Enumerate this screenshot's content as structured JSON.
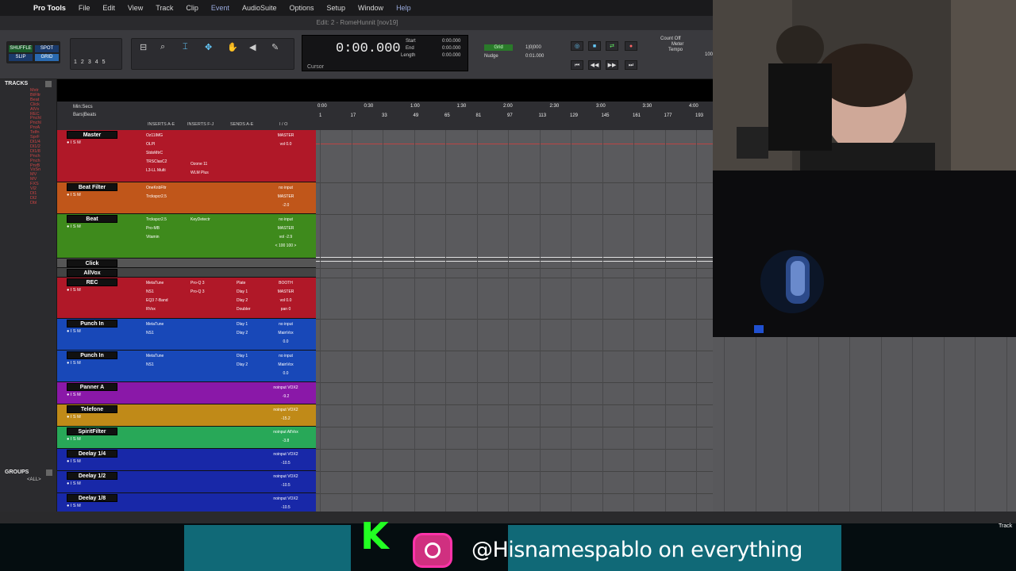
{
  "menubar": {
    "app": "Pro Tools",
    "items": [
      "File",
      "Edit",
      "View",
      "Track",
      "Clip",
      "Event",
      "AudioSuite",
      "Options",
      "Setup",
      "Window",
      "Help"
    ]
  },
  "window_title": "Edit: 2 - RomeHunnit [nov19]",
  "toolbar": {
    "mode_shuffle": "SHUFFLE",
    "mode_spot": "SPOT",
    "mode_slip": "SLIP",
    "mode_grid": "GRID",
    "zoom_presets": [
      "1",
      "2",
      "3",
      "4",
      "5"
    ],
    "counter_main": "0:00.000",
    "start_label": "Start",
    "end_label": "End",
    "length_label": "Length",
    "start_val": "0:00.000",
    "end_val": "0:00.000",
    "length_val": "0:00.000",
    "cursor_label": "Cursor",
    "grid_label": "Grid",
    "nudge_label": "Nudge",
    "grid_val": "1|0|000",
    "nudge_val": "0:01.000",
    "count_off": "Count Off",
    "meter": "Meter",
    "tempo": "Tempo",
    "tempo_val": "100"
  },
  "tracks_panel": {
    "header": "TRACKS",
    "items": [
      "Mstr",
      "BtFltr",
      "Beat",
      "Click",
      "AlVx",
      "REC",
      "Pnchl",
      "Pnchl",
      "PnrA",
      "Telfn",
      "SprF",
      "Dl1/4",
      "Dl1/2",
      "Dl1/8",
      "Pnch",
      "Pnch",
      "PnrB",
      "VxSn",
      "MV",
      "MV",
      "FXS",
      "Vl2",
      "Dl1",
      "Dl2",
      "Dbl"
    ],
    "groups_header": "GROUPS",
    "groups_all": "<ALL>"
  },
  "mix_header": {
    "timecode": "Min:Secs",
    "bars": "Bars|Beats",
    "col_inserts_ae": "INSERTS A-E",
    "col_inserts_fj": "INSERTS F-J",
    "col_sends": "SENDS A-E",
    "col_io": "I / O"
  },
  "ruler": {
    "minsecs": [
      "0:00",
      "0:30",
      "1:00",
      "1:30",
      "2:00",
      "2:30",
      "3:00",
      "3:30",
      "4:00"
    ],
    "bars": [
      "1",
      "17",
      "33",
      "49",
      "65",
      "81",
      "97",
      "113",
      "129",
      "145",
      "161",
      "177",
      "193"
    ]
  },
  "tracks": [
    {
      "name": "Master",
      "color": "#b01828",
      "inserts": [
        "Oz11IMG",
        "OLPI",
        "StdoMtrC",
        "TRSClasC2",
        "L3-LL Multi"
      ],
      "inserts2": [
        "Ozone 11",
        "WLM Plus"
      ],
      "io": [
        "MASTER",
        "vol  0.0"
      ]
    },
    {
      "name": "Beat Filter",
      "color": "#c0561a",
      "inserts": [
        "OneKnbFltr",
        "Trckspcr2.5"
      ],
      "inserts2": [],
      "io": [
        "no input",
        "MASTER",
        "-2.0"
      ]
    },
    {
      "name": "Beat",
      "color": "#3e8a1c",
      "inserts": [
        "Trckspcr2.5",
        "Pro-MB",
        "Vitamin"
      ],
      "inserts2": [
        "KeyDetectr"
      ],
      "io": [
        "no input",
        "MASTER",
        "vol  -2.9",
        "< 100  100 >"
      ]
    },
    {
      "name": "Click",
      "color": "#555",
      "inserts": [],
      "inserts2": [],
      "io": []
    },
    {
      "name": "AllVox",
      "color": "#444",
      "inserts": [],
      "inserts2": [],
      "io": []
    },
    {
      "name": "REC",
      "color": "#b01828",
      "inserts": [
        "MetaTune",
        "NS1",
        "EQ3 7-Band",
        "RVox"
      ],
      "inserts2": [
        "Pro-Q 3",
        "Pro-Q 3"
      ],
      "io": [
        "BOOTH",
        "MASTER",
        "vol  0.0",
        "pan  0"
      ],
      "sends": [
        "Plate",
        "Dlay 1",
        "Dlay 2",
        "Doubler"
      ]
    },
    {
      "name": "Punch In",
      "color": "#1848b8",
      "inserts": [
        "MetaTune",
        "NS1"
      ],
      "inserts2": [],
      "io": [
        "no input",
        "MainVox",
        "0.0"
      ],
      "sends": [
        "Dlay 1",
        "Dlay 2"
      ]
    },
    {
      "name": "Punch In",
      "color": "#1848b8",
      "inserts": [
        "MetaTune",
        "NS1"
      ],
      "inserts2": [],
      "io": [
        "no input",
        "MainVox",
        "0.0"
      ],
      "sends": [
        "Dlay 1",
        "Dlay 2"
      ]
    },
    {
      "name": "Panner A",
      "color": "#8a18a8",
      "inserts": [],
      "inserts2": [],
      "io": [
        "noinput VOX2",
        "-9.2"
      ]
    },
    {
      "name": "Telefone",
      "color": "#c08a18",
      "inserts": [],
      "inserts2": [],
      "io": [
        "noinput VOX2",
        "-15.2"
      ]
    },
    {
      "name": "SpiritFilter",
      "color": "#28a858",
      "inserts": [],
      "inserts2": [],
      "io": [
        "noinput AllVox",
        "-3.8"
      ]
    },
    {
      "name": "Deelay 1/4",
      "color": "#1828a8",
      "inserts": [],
      "inserts2": [],
      "io": [
        "noinput VOX2",
        "-10.5"
      ]
    },
    {
      "name": "Deelay 1/2",
      "color": "#1828a8",
      "inserts": [],
      "inserts2": [],
      "io": [
        "noinput VOX2",
        "-10.5"
      ]
    },
    {
      "name": "Deelay 1/8",
      "color": "#1828a8",
      "inserts": [],
      "inserts2": [],
      "io": [
        "noinput VOX2",
        "-10.5"
      ]
    }
  ],
  "overlay": {
    "social": "@Hisnamespablo on everything",
    "track_label": "Track"
  },
  "colors": {
    "timeline_bg": "#5a5a5d",
    "accent_cyan": "#1ab6cc",
    "logo_green": "#22ff22"
  }
}
